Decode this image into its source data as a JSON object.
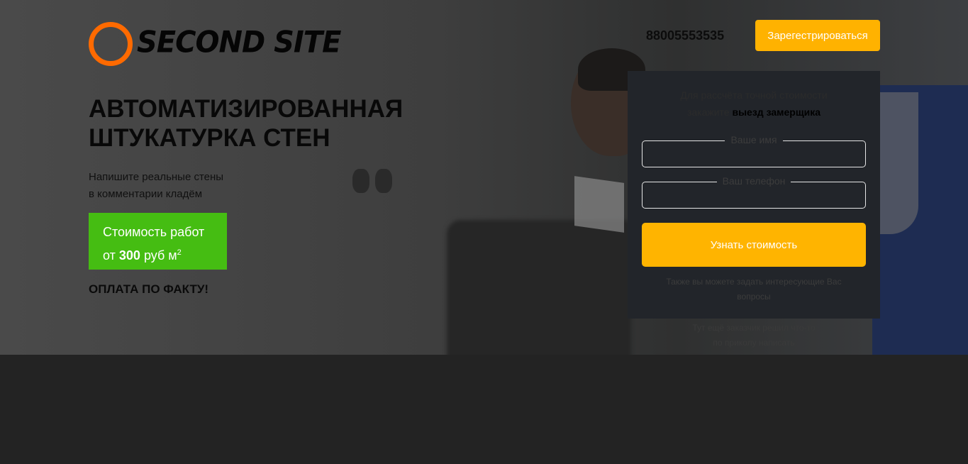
{
  "header": {
    "logo_text": "SECOND SITE",
    "phone": "88005553535",
    "register_label": "Зарегестрироваться"
  },
  "hero": {
    "headline_line1": "АВТОМАТИЗИРОВАННАЯ",
    "headline_line2": "ШТУКАТУРКА СТЕН",
    "sub_line1": "Напишите реальные стены",
    "sub_line2": "в комментарии кладём",
    "price_line1": "Стоимость работ",
    "price_prefix": "от",
    "price_value": "300",
    "price_unit": "руб м",
    "price_exp": "2",
    "payment": "ОПЛАТА ПО ФАКТУ!"
  },
  "form": {
    "intro_line1": "Для рассчёта точной стоимости",
    "intro_line2_prefix": "закажите",
    "intro_line2_bold": "выезд замерщика",
    "name_label": "Ваше имя",
    "phone_label": "Ваш телефон",
    "submit_label": "Узнать стоимость",
    "note": "Также вы можете задать интересующие Вас вопросы"
  },
  "extra_note_line1": "Тут ещё заказчик решил что-то",
  "extra_note_line2": "по приколу написать",
  "colors": {
    "accent": "#ffb200",
    "price_green": "#45bd12",
    "logo_orange": "#ff6a00",
    "footer_bg": "#232323"
  }
}
